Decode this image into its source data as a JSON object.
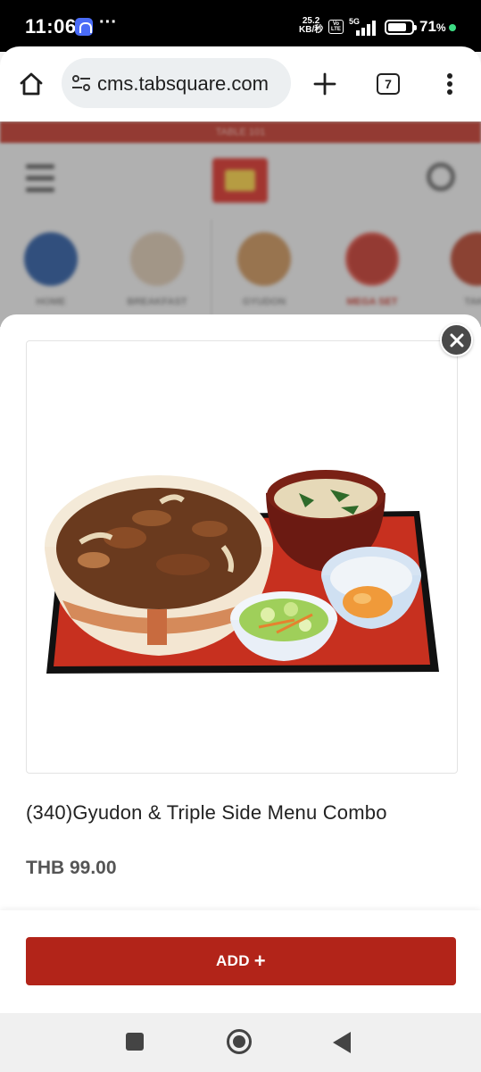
{
  "status_bar": {
    "time": "11:06",
    "more": "···",
    "speed_value": "25.2",
    "speed_unit": "KB/秒",
    "network": "5G",
    "volte": "Vo LTE",
    "battery_percent": "71",
    "battery_symbol": "%"
  },
  "browser": {
    "url": "cms.tabsquare.com",
    "tab_count": "7"
  },
  "background_page": {
    "banner_text": "TABLE 101",
    "categories": [
      "HOME",
      "BREAKFAST",
      "GYUDON",
      "MEGA SET",
      "TAKE"
    ]
  },
  "product": {
    "name": "(340)Gyudon & Triple Side Menu Combo",
    "price": "THB 99.00",
    "add_label": "ADD",
    "add_icon": "+"
  },
  "colors": {
    "accent": "#b22419",
    "banner": "#c23a2e"
  }
}
